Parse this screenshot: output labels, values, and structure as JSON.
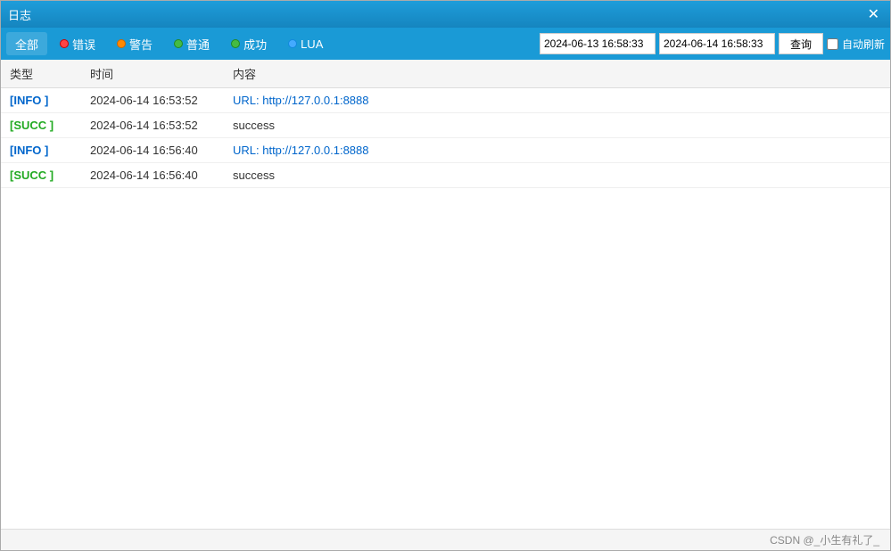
{
  "window": {
    "title": "日志",
    "close_label": "✕"
  },
  "toolbar": {
    "all_label": "全部",
    "error_label": "错误",
    "warning_label": "警告",
    "normal_label": "普通",
    "success_label": "成功",
    "lua_label": "LUA",
    "date_start": "2024-06-13 16:58:33",
    "date_end": "2024-06-14 16:58:33",
    "query_label": "查询",
    "auto_refresh_label": "自动刷新"
  },
  "table": {
    "headers": [
      "类型",
      "时间",
      "内容"
    ],
    "rows": [
      {
        "type": "[INFO ]",
        "type_class": "info",
        "time": "2024-06-14 16:53:52",
        "content": "URL: http://127.0.0.1:8888",
        "content_class": "url"
      },
      {
        "type": "[SUCC ]",
        "type_class": "succ",
        "time": "2024-06-14 16:53:52",
        "content": "success",
        "content_class": "normal"
      },
      {
        "type": "[INFO ]",
        "type_class": "info",
        "time": "2024-06-14 16:56:40",
        "content": "URL: http://127.0.0.1:8888",
        "content_class": "url"
      },
      {
        "type": "[SUCC ]",
        "type_class": "succ",
        "time": "2024-06-14 16:56:40",
        "content": "success",
        "content_class": "normal"
      }
    ]
  },
  "footer": {
    "text": "CSDN @_小生有礼了_"
  }
}
